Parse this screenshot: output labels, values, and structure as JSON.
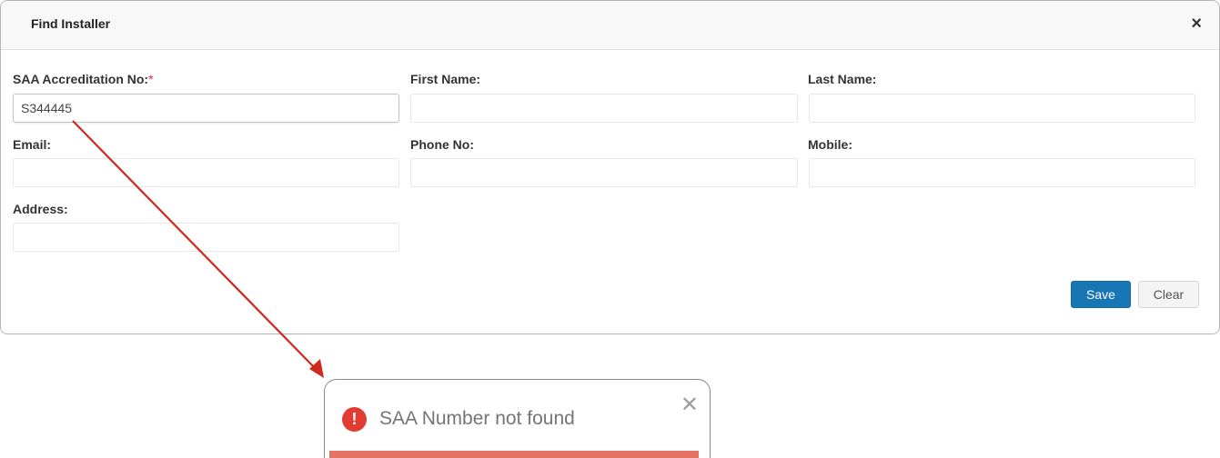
{
  "modal": {
    "title": "Find Installer",
    "close_glyph": "×"
  },
  "form": {
    "saa": {
      "label": "SAA Accreditation No:",
      "required_mark": "*",
      "value": "S344445"
    },
    "first_name": {
      "label": "First Name:",
      "value": ""
    },
    "last_name": {
      "label": "Last Name:",
      "value": ""
    },
    "email": {
      "label": "Email:",
      "value": ""
    },
    "phone": {
      "label": "Phone No:",
      "value": ""
    },
    "mobile": {
      "label": "Mobile:",
      "value": ""
    },
    "address": {
      "label": "Address:",
      "value": ""
    }
  },
  "buttons": {
    "save_label": "Save",
    "clear_label": "Clear",
    "save_color": "#1976b5"
  },
  "toast": {
    "icon_glyph": "!",
    "message": "SAA Number not found",
    "close_glyph": "✕",
    "icon_color": "#e23b32",
    "bar_color": "#e57363"
  },
  "annotation": {
    "arrow_color": "#d0281d"
  }
}
